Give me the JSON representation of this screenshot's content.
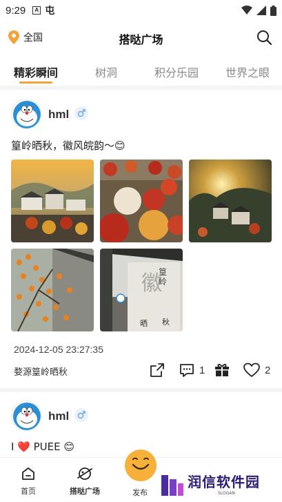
{
  "status_bar": {
    "time": "9:29",
    "icon_a": "A",
    "icon_glyph": "屯"
  },
  "header": {
    "location": "全国",
    "title": "搭哒广场"
  },
  "tabs": [
    "精彩瞬间",
    "树洞",
    "积分乐园",
    "世界之眼"
  ],
  "posts": [
    {
      "username": "hml",
      "text": "篁岭晒秋，徽风皖韵～😊",
      "timestamp": "2024-12-05 23:27:35",
      "location": "婺源篁岭晒秋",
      "comments": "1",
      "likes": "2",
      "photos": [
        "village-mist-photo",
        "drying-peppers-photo",
        "sunset-village-photo",
        "persimmon-tree-photo",
        "huizhou-gate-photo"
      ]
    },
    {
      "username": "hml",
      "text": "I ❤️ PUEE 😊"
    }
  ],
  "bottom_nav": {
    "home": "首页",
    "square": "搭哒广场",
    "publish": "发布"
  },
  "watermark": {
    "text": "润信软件园",
    "slogan": "SLOGAN"
  },
  "colors": {
    "accent": "#f4a23a",
    "location_pin": "#f4a23a",
    "watermark": "#2d1a73"
  }
}
